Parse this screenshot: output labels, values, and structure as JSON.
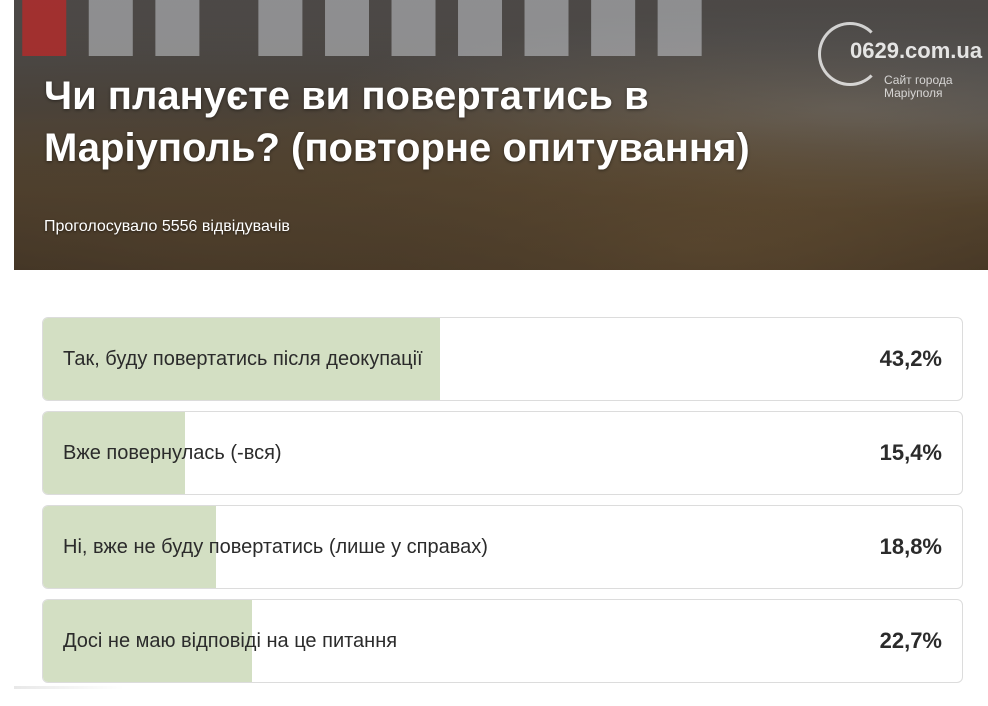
{
  "hero": {
    "title": "Чи плануєте ви повертатись в Маріуполь? (повторне опитування)",
    "votes_text": "Проголосувало 5556 відвідувачів"
  },
  "logo": {
    "domain": "0629.com.ua",
    "subtitle": "Сайт города Маріуполя"
  },
  "poll": {
    "bar_color": "#d3dfc3",
    "options": [
      {
        "label": "Так, буду повертатись після деокупації",
        "percent": "43,2%",
        "value": 43.2
      },
      {
        "label": "Вже повернулась (-вся)",
        "percent": "15,4%",
        "value": 15.4
      },
      {
        "label": "Ні, вже не буду повертатись (лише у справах)",
        "percent": "18,8%",
        "value": 18.8
      },
      {
        "label": "Досі не маю відповіді на це питання",
        "percent": "22,7%",
        "value": 22.7
      }
    ]
  }
}
